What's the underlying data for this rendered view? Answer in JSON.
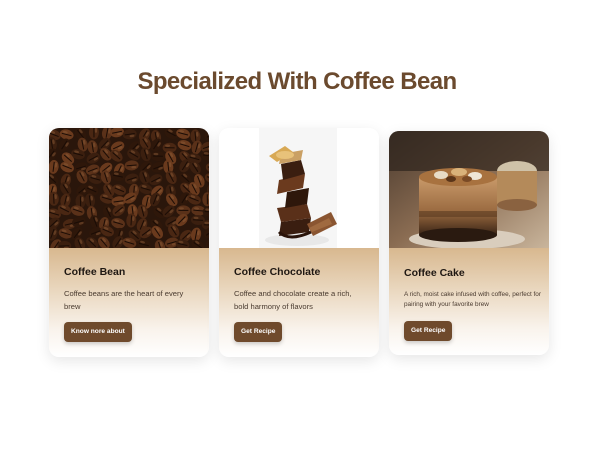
{
  "section": {
    "title": "Specialized With Coffee Bean"
  },
  "cards": [
    {
      "title": "Coffee Bean",
      "description": "Coffee beans are the heart of every brew",
      "button_label": "Know nore about",
      "image": "coffee-beans-photo"
    },
    {
      "title": "Coffee Chocolate",
      "description": "Coffee and chocolate create a rich, bold harmony of flavors",
      "button_label": "Get Recipe",
      "image": "chocolate-tower-photo"
    },
    {
      "title": "Coffee Cake",
      "description": "A rich, moist cake infused with coffee, perfect for pairing with your favorite brew",
      "button_label": "Get  Recipe",
      "image": "coffee-cake-photo"
    }
  ],
  "colors": {
    "heading": "#6b4a2e",
    "button": "#6f4a2c",
    "card_tint": "#d8b88f"
  }
}
